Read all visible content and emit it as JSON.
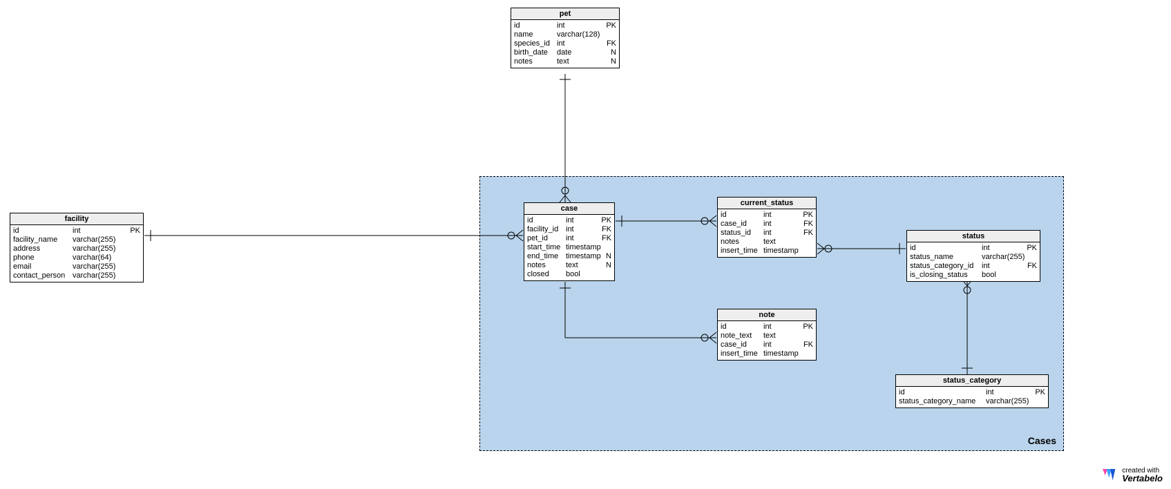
{
  "region": {
    "label": "Cases"
  },
  "entities": {
    "pet": {
      "title": "pet",
      "rows": [
        {
          "name": "id",
          "type": "int",
          "flag": "PK"
        },
        {
          "name": "name",
          "type": "varchar(128)",
          "flag": ""
        },
        {
          "name": "species_id",
          "type": "int",
          "flag": "FK"
        },
        {
          "name": "birth_date",
          "type": "date",
          "flag": "N"
        },
        {
          "name": "notes",
          "type": "text",
          "flag": "N"
        }
      ]
    },
    "facility": {
      "title": "facility",
      "rows": [
        {
          "name": "id",
          "type": "int",
          "flag": "PK"
        },
        {
          "name": "facility_name",
          "type": "varchar(255)",
          "flag": ""
        },
        {
          "name": "address",
          "type": "varchar(255)",
          "flag": ""
        },
        {
          "name": "phone",
          "type": "varchar(64)",
          "flag": ""
        },
        {
          "name": "email",
          "type": "varchar(255)",
          "flag": ""
        },
        {
          "name": "contact_person",
          "type": "varchar(255)",
          "flag": ""
        }
      ]
    },
    "case": {
      "title": "case",
      "rows": [
        {
          "name": "id",
          "type": "int",
          "flag": "PK"
        },
        {
          "name": "facility_id",
          "type": "int",
          "flag": "FK"
        },
        {
          "name": "pet_id",
          "type": "int",
          "flag": "FK"
        },
        {
          "name": "start_time",
          "type": "timestamp",
          "flag": ""
        },
        {
          "name": "end_time",
          "type": "timestamp",
          "flag": "N"
        },
        {
          "name": "notes",
          "type": "text",
          "flag": "N"
        },
        {
          "name": "closed",
          "type": "bool",
          "flag": ""
        }
      ]
    },
    "current_status": {
      "title": "current_status",
      "rows": [
        {
          "name": "id",
          "type": "int",
          "flag": "PK"
        },
        {
          "name": "case_id",
          "type": "int",
          "flag": "FK"
        },
        {
          "name": "status_id",
          "type": "int",
          "flag": "FK"
        },
        {
          "name": "notes",
          "type": "text",
          "flag": ""
        },
        {
          "name": "insert_time",
          "type": "timestamp",
          "flag": ""
        }
      ]
    },
    "note": {
      "title": "note",
      "rows": [
        {
          "name": "id",
          "type": "int",
          "flag": "PK"
        },
        {
          "name": "note_text",
          "type": "text",
          "flag": ""
        },
        {
          "name": "case_id",
          "type": "int",
          "flag": "FK"
        },
        {
          "name": "insert_time",
          "type": "timestamp",
          "flag": ""
        }
      ]
    },
    "status": {
      "title": "status",
      "rows": [
        {
          "name": "id",
          "type": "int",
          "flag": "PK"
        },
        {
          "name": "status_name",
          "type": "varchar(255)",
          "flag": ""
        },
        {
          "name": "status_category_id",
          "type": "int",
          "flag": "FK"
        },
        {
          "name": "is_closing_status",
          "type": "bool",
          "flag": ""
        }
      ]
    },
    "status_category": {
      "title": "status_category",
      "rows": [
        {
          "name": "id",
          "type": "int",
          "flag": "PK"
        },
        {
          "name": "status_category_name",
          "type": "varchar(255)",
          "flag": ""
        }
      ]
    }
  },
  "watermark": {
    "created": "created with",
    "brand": "Vertabelo"
  }
}
